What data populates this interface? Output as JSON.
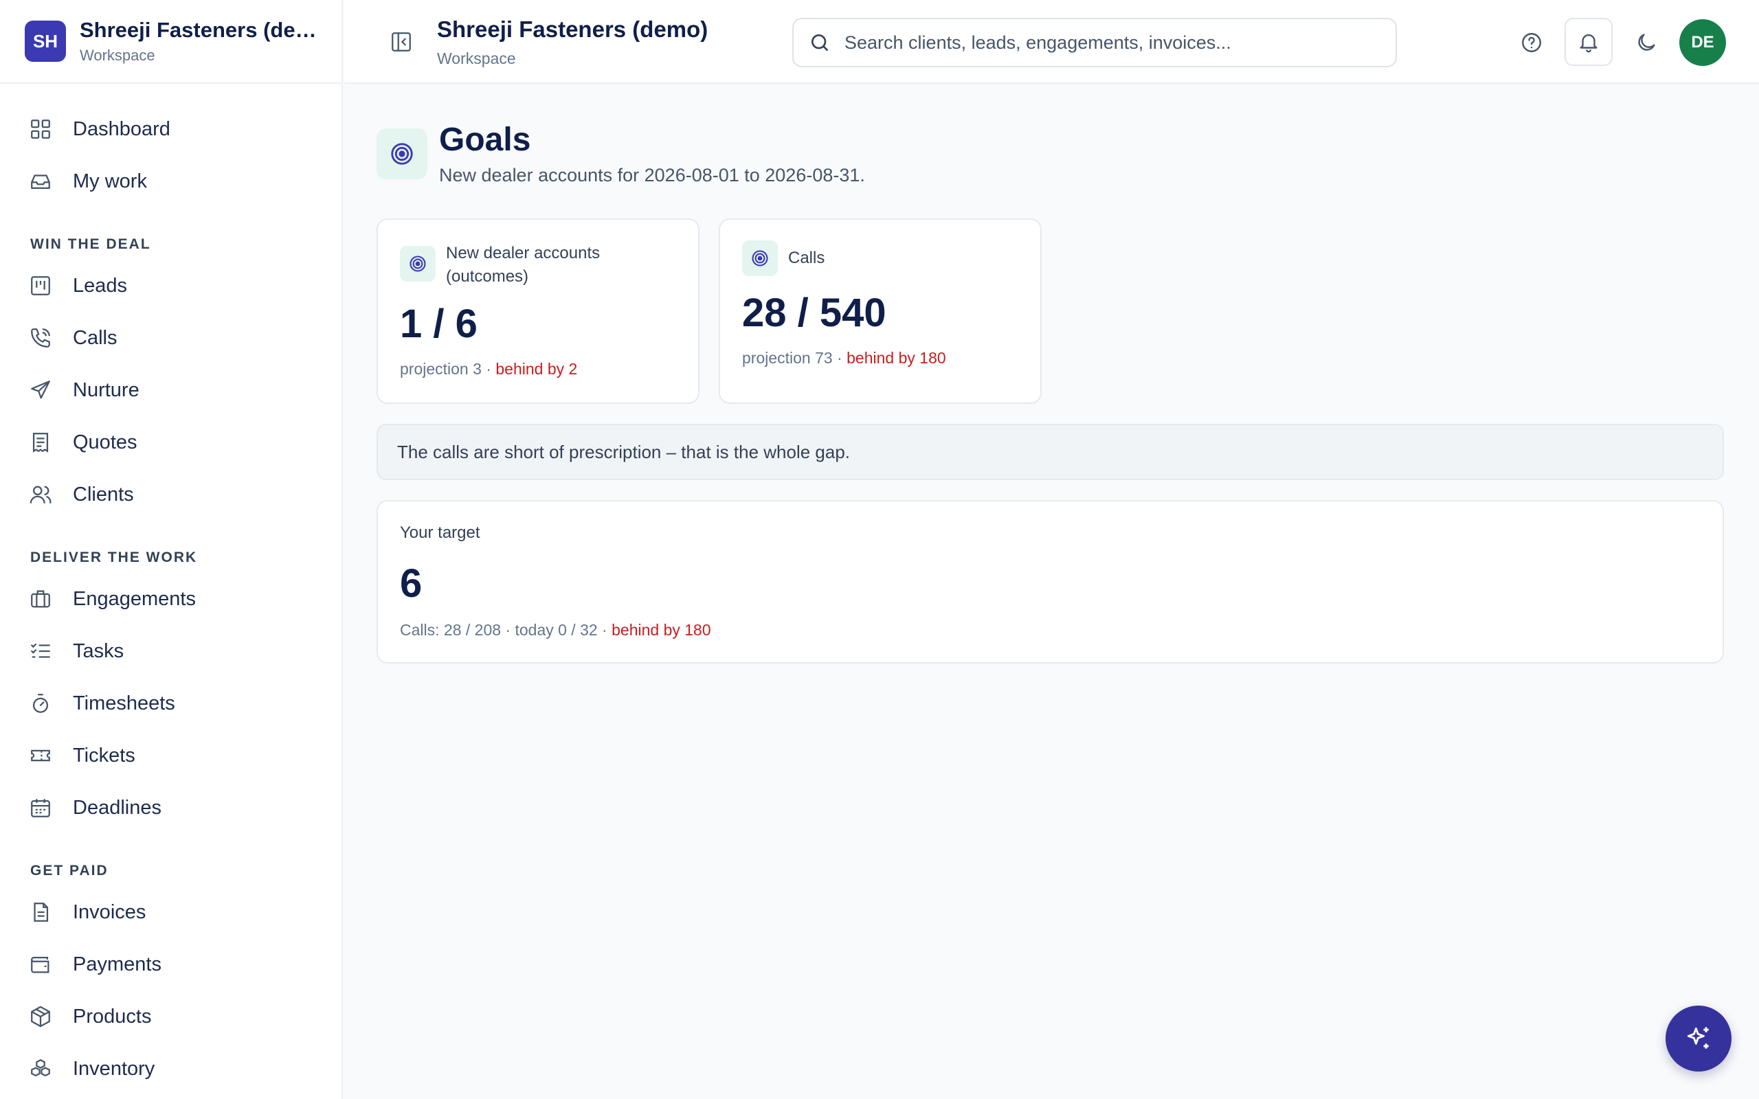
{
  "brand": {
    "initials": "SH",
    "name": "Shreeji Fasteners (demo)",
    "subtitle": "Workspace"
  },
  "header": {
    "title": "Shreeji Fasteners (demo)",
    "subtitle": "Workspace",
    "search_placeholder": "Search clients, leads, engagements, invoices...",
    "avatar_initials": "DE"
  },
  "nav": {
    "top": [
      {
        "label": "Dashboard",
        "icon": "grid-icon"
      },
      {
        "label": "My work",
        "icon": "inbox-icon"
      }
    ],
    "win_title": "WIN THE DEAL",
    "win": [
      {
        "label": "Leads",
        "icon": "kanban-icon"
      },
      {
        "label": "Calls",
        "icon": "phone-icon"
      },
      {
        "label": "Nurture",
        "icon": "send-icon"
      },
      {
        "label": "Quotes",
        "icon": "receipt-icon"
      },
      {
        "label": "Clients",
        "icon": "users-icon"
      }
    ],
    "deliver_title": "DELIVER THE WORK",
    "deliver": [
      {
        "label": "Engagements",
        "icon": "briefcase-icon"
      },
      {
        "label": "Tasks",
        "icon": "checklist-icon"
      },
      {
        "label": "Timesheets",
        "icon": "timer-icon"
      },
      {
        "label": "Tickets",
        "icon": "ticket-icon"
      },
      {
        "label": "Deadlines",
        "icon": "calendar-icon"
      }
    ],
    "paid_title": "GET PAID",
    "paid": [
      {
        "label": "Invoices",
        "icon": "file-icon"
      },
      {
        "label": "Payments",
        "icon": "wallet-icon"
      },
      {
        "label": "Products",
        "icon": "box-icon"
      },
      {
        "label": "Inventory",
        "icon": "boxes-icon"
      }
    ]
  },
  "page": {
    "title": "Goals",
    "subtitle": "New dealer accounts for 2026-08-01 to 2026-08-31."
  },
  "cards": {
    "outcomes": {
      "label_line1": "New dealer accounts",
      "label_line2": "(outcomes)",
      "value": "1 / 6",
      "projection": "projection 3 · ",
      "status": "behind by 2"
    },
    "calls": {
      "label": "Calls",
      "value": "28 / 540",
      "projection": "projection 73 · ",
      "status": "behind by 180"
    }
  },
  "notice": "The calls are short of prescription – that is the whole gap.",
  "target": {
    "label": "Your target",
    "value": "6",
    "detail": "Calls: 28 / 208 · today 0 / 32 · ",
    "status": "behind by 180"
  },
  "colors": {
    "accent": "#3b3ab3",
    "avatar": "#17804a",
    "behind": "#c81e1e",
    "icon_bg": "#e4f4ee"
  }
}
